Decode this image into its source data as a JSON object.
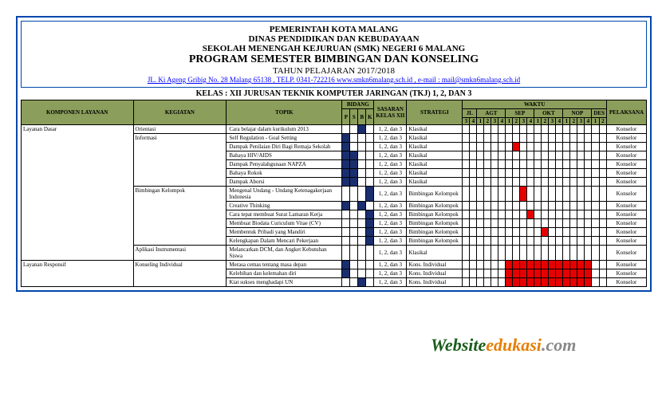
{
  "header": {
    "l1": "PEMERINTAH KOTA MALANG",
    "l2": "DINAS PENDIDIKAN DAN KEBUDAYAAN",
    "l3": "SEKOLAH MENENGAH KEJURUAN (SMK) NEGERI 6 MALANG",
    "title": "PROGRAM SEMESTER BIMBINGAN DAN KONSELING",
    "year": "TAHUN PELAJARAN 2017/2018",
    "addr": "JL. Ki Ageng Gribig No. 28 Malang 65138 , TELP. 0341-722216 www.smkn6malang.sch.id , e-mail : mail@smkn6malang.sch.id",
    "kelas": "KELAS : XII JURUSAN TEKNIK KOMPUTER JARINGAN (TKJ) 1, 2, DAN 3"
  },
  "cols": {
    "komponen": "KOMPONEN LAYANAN",
    "kegiatan": "KEGIATAN",
    "topik": "TOPIK",
    "bidang": "BIDANG",
    "p": "P",
    "s": "S",
    "b": "B",
    "k": "K",
    "sasaran": "SASARAN KELAS XII",
    "strategi": "STRATEGI",
    "waktu": "WAKTU",
    "pelaksana": "PELAKSANA",
    "jl": "JL",
    "agt": "AGT",
    "sep": "SEP",
    "okt": "OKT",
    "nop": "NOP",
    "des": "DES",
    "w": [
      "3",
      "4",
      "1",
      "2",
      "3",
      "4",
      "1",
      "2",
      "3",
      "4",
      "1",
      "2",
      "3",
      "4",
      "1",
      "2",
      "3",
      "4",
      "1",
      "2"
    ]
  },
  "komp": {
    "dasar": "Layanan Dasar",
    "responsif": "Layanan Responsif"
  },
  "keg": {
    "orientasi": "Orientasi",
    "informasi": "Informasi",
    "bimbingan": "Bimbingan Kelompok",
    "aplikasi": "Aplikasi Instrumentasi",
    "konseling": "Konseling Individual"
  },
  "sas_all": "1, 2, dan 3",
  "str": {
    "klasikal": "Klasikal",
    "bimkel": "Bimbingan Kelompok",
    "kons": "Kons. Individual"
  },
  "pel": "Konselor",
  "rows": [
    {
      "t": "Cara belajar dalam kurikulum 2013",
      "b": [
        0,
        0,
        1,
        0
      ],
      "s": "klasikal",
      "w": []
    },
    {
      "t": "Self Regulation - Goal Setting",
      "b": [
        1,
        0,
        0,
        0
      ],
      "s": "klasikal",
      "w": []
    },
    {
      "t": "Dampak Penilaian Diri Bagi Remaja Sekolah",
      "b": [
        1,
        0,
        0,
        0
      ],
      "s": "klasikal",
      "w": [
        7
      ]
    },
    {
      "t": "Bahaya HIV/AIDS",
      "b": [
        1,
        1,
        0,
        0
      ],
      "s": "klasikal",
      "w": []
    },
    {
      "t": "Dampak Penyalahgunaan NAPZA",
      "b": [
        1,
        1,
        0,
        0
      ],
      "s": "klasikal",
      "w": []
    },
    {
      "t": "Bahaya Rokok",
      "b": [
        1,
        1,
        0,
        0
      ],
      "s": "klasikal",
      "w": []
    },
    {
      "t": "Dampak Aborsi",
      "b": [
        1,
        1,
        0,
        0
      ],
      "s": "klasikal",
      "w": []
    },
    {
      "t": "Mengenal Undang - Undang Ketenagakerjaan Indonesia",
      "b": [
        0,
        0,
        0,
        1
      ],
      "s": "bimkel",
      "w": [
        8
      ]
    },
    {
      "t": "Creative Thinking",
      "b": [
        1,
        0,
        1,
        0
      ],
      "s": "bimkel",
      "w": []
    },
    {
      "t": "Cara tepat membuat Surat Lamaran Kerja",
      "b": [
        0,
        0,
        0,
        1
      ],
      "s": "bimkel",
      "w": [
        9
      ]
    },
    {
      "t": "Membuat Biodata Curiculum Vitae (CV)",
      "b": [
        0,
        0,
        0,
        1
      ],
      "s": "bimkel",
      "w": []
    },
    {
      "t": "Membentuk Pribadi yang Mandiri",
      "b": [
        0,
        0,
        0,
        1
      ],
      "s": "bimkel",
      "w": [
        11
      ]
    },
    {
      "t": "Kelengkapan Dalam Mencari Pekerjaan",
      "b": [
        0,
        0,
        0,
        1
      ],
      "s": "bimkel",
      "w": []
    },
    {
      "t": "Melancarkan DCM, dan Angket Kebutuhan Siswa",
      "b": [
        0,
        0,
        0,
        0
      ],
      "s": "klasikal",
      "w": []
    },
    {
      "t": "Merasa cemas tentang masa depan",
      "b": [
        1,
        0,
        0,
        0
      ],
      "s": "kons",
      "w": [
        6,
        7,
        8,
        9,
        10,
        11,
        12,
        13,
        14,
        15,
        16,
        17
      ]
    },
    {
      "t": "Kelebihan dan kelemahan diri",
      "b": [
        1,
        0,
        0,
        0
      ],
      "s": "kons",
      "w": [
        6,
        7,
        8,
        9,
        10,
        11,
        12,
        13,
        14,
        15,
        16,
        17
      ]
    },
    {
      "t": "Kiat sukses menghadapi UN",
      "b": [
        0,
        0,
        1,
        0
      ],
      "s": "kons",
      "w": [
        6,
        7,
        8,
        9,
        10,
        11,
        12,
        13,
        14,
        15,
        16,
        17
      ]
    }
  ],
  "watermark": {
    "w": "Website",
    "e": "edukasi",
    "c": ".com"
  }
}
